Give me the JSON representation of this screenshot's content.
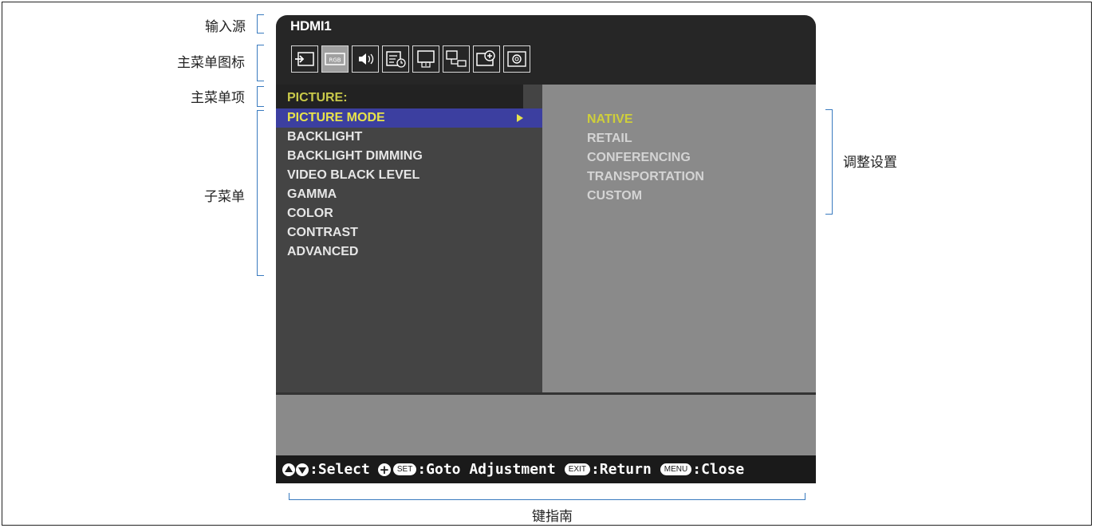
{
  "callouts": {
    "input_source": "输入源",
    "main_menu_icons": "主菜单图标",
    "main_menu_item": "主菜单项",
    "submenu": "子菜单",
    "adjustment_settings": "调整设置",
    "key_guide": "键指南"
  },
  "osd": {
    "input_name": "HDMI1",
    "main_menu_label": "PICTURE:",
    "menu_icons": [
      "input-icon",
      "rgb-picture-icon",
      "audio-icon",
      "schedule-icon",
      "display-icon",
      "multi-input-icon",
      "protect-icon",
      "system-icon"
    ],
    "selected_icon_index": 1,
    "submenu_items": [
      "PICTURE MODE",
      "BACKLIGHT",
      "BACKLIGHT DIMMING",
      "VIDEO BLACK LEVEL",
      "GAMMA",
      "COLOR",
      "CONTRAST",
      "ADVANCED"
    ],
    "selected_submenu_index": 0,
    "options": [
      "NATIVE",
      "RETAIL",
      "CONFERENCING",
      "TRANSPORTATION",
      "CUSTOM"
    ],
    "selected_option_index": 0,
    "key_guide": {
      "select": ":Select",
      "set_pill": "SET",
      "goto": ":Goto Adjustment",
      "exit_pill": "EXIT",
      "return": ":Return",
      "menu_pill": "MENU",
      "close": ":Close"
    }
  },
  "colors": {
    "highlight_bar": "#3c3fa0",
    "highlight_text": "#e8e34a",
    "option_selected": "#cfcf3a",
    "bracket": "#3a7bbf"
  }
}
